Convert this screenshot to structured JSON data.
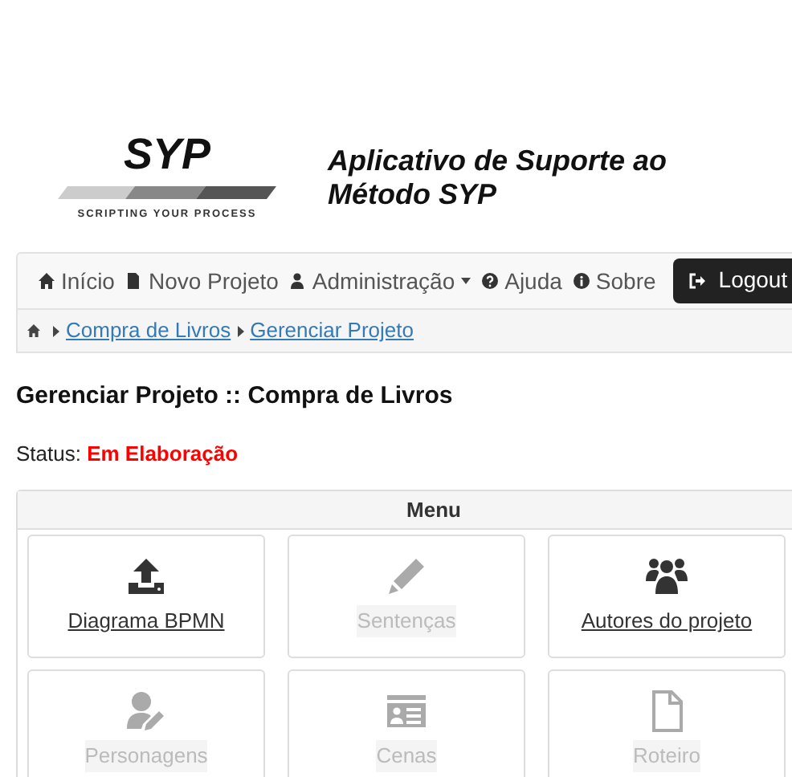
{
  "logo": {
    "name": "SYP",
    "tagline": "SCRIPTING YOUR PROCESS"
  },
  "app_title": "Aplicativo de Suporte ao Método SYP",
  "navbar": {
    "items": [
      {
        "label": "Início",
        "dropdown": false
      },
      {
        "label": "Novo Projeto",
        "dropdown": false
      },
      {
        "label": "Administração",
        "dropdown": true
      },
      {
        "label": "Ajuda",
        "dropdown": false
      },
      {
        "label": "Sobre",
        "dropdown": false
      }
    ],
    "logout": "Logout"
  },
  "breadcrumb": [
    "Compra de Livros",
    "Gerenciar Projeto"
  ],
  "page_title": "Gerenciar Projeto :: Compra de Livros",
  "status": {
    "label": "Status:",
    "value": "Em Elaboração"
  },
  "menu": {
    "title": "Menu",
    "items": [
      {
        "label": "Diagrama BPMN",
        "disabled": false
      },
      {
        "label": "Sentenças",
        "disabled": true
      },
      {
        "label": "Autores do projeto",
        "disabled": false
      },
      {
        "label": "Personagens",
        "disabled": true
      },
      {
        "label": "Cenas",
        "disabled": true
      },
      {
        "label": "Roteiro",
        "disabled": true
      }
    ]
  }
}
